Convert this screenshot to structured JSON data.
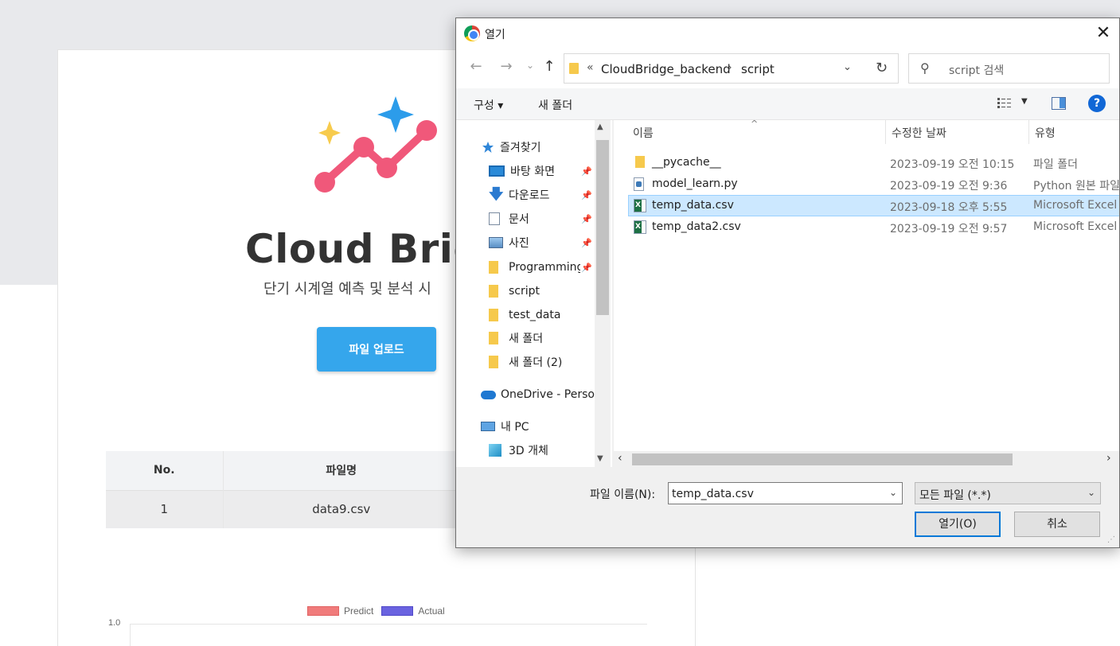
{
  "web": {
    "brand_title": "Cloud Brid",
    "brand_subtitle": "단기 시계열 예측 및 분석 시",
    "upload_button": "파일 업로드",
    "table": {
      "headers": [
        "No.",
        "파일명"
      ],
      "rows": [
        [
          "1",
          "data9.csv"
        ]
      ]
    },
    "chart": {
      "legend": [
        "Predict",
        "Actual"
      ],
      "y_tick": "1.0",
      "colors": {
        "predict": "#f07b7b",
        "actual": "#6a63e0"
      }
    }
  },
  "dialog": {
    "title": "열기",
    "close_label": "✕",
    "nav": {
      "back": "←",
      "forward": "→",
      "recent": "⌄",
      "up": "↑"
    },
    "address": {
      "crumbs": [
        "«",
        "CloudBridge_backend",
        "›",
        "script"
      ],
      "dropdown": "⌄"
    },
    "refresh": "↻",
    "search_placeholder": "script 검색",
    "toolbar": {
      "organize": "구성 ▾",
      "new_folder": "새 폴더",
      "help": "?"
    },
    "sidebar": [
      {
        "label": "즐겨찾기",
        "icon": "star-icon"
      },
      {
        "label": "바탕 화면",
        "icon": "desktop-icon",
        "pinned": true
      },
      {
        "label": "다운로드",
        "icon": "download-icon",
        "pinned": true
      },
      {
        "label": "문서",
        "icon": "document-icon",
        "pinned": true
      },
      {
        "label": "사진",
        "icon": "picture-icon",
        "pinned": true
      },
      {
        "label": "Programming",
        "icon": "folder-icon",
        "pinned": true
      },
      {
        "label": "script",
        "icon": "folder-icon"
      },
      {
        "label": "test_data",
        "icon": "folder-icon"
      },
      {
        "label": "새 폴더",
        "icon": "folder-icon"
      },
      {
        "label": "새 폴더 (2)",
        "icon": "folder-icon"
      },
      {
        "label": "OneDrive - Person",
        "icon": "cloud-icon"
      },
      {
        "label": "내 PC",
        "icon": "computer-icon"
      },
      {
        "label": "3D 개체",
        "icon": "cube-icon"
      }
    ],
    "columns": {
      "name": "이름",
      "modified": "수정한 날짜",
      "type": "유형"
    },
    "files": [
      {
        "name": "__pycache__",
        "date": "2023-09-19 오전 10:15",
        "type": "파일 폴더",
        "icon": "folder-icon"
      },
      {
        "name": "model_learn.py",
        "date": "2023-09-19 오전 9:36",
        "type": "Python 원본 파일",
        "icon": "python-file-icon"
      },
      {
        "name": "temp_data.csv",
        "date": "2023-09-18 오후 5:55",
        "type": "Microsoft Excel",
        "icon": "excel-file-icon",
        "selected": true
      },
      {
        "name": "temp_data2.csv",
        "date": "2023-09-19 오전 9:57",
        "type": "Microsoft Excel",
        "icon": "excel-file-icon"
      }
    ],
    "filename_label": "파일 이름(N):",
    "filename_value": "temp_data.csv",
    "filetype": "모든 파일 (*.*)",
    "open_button": "열기(O)",
    "cancel_button": "취소"
  }
}
